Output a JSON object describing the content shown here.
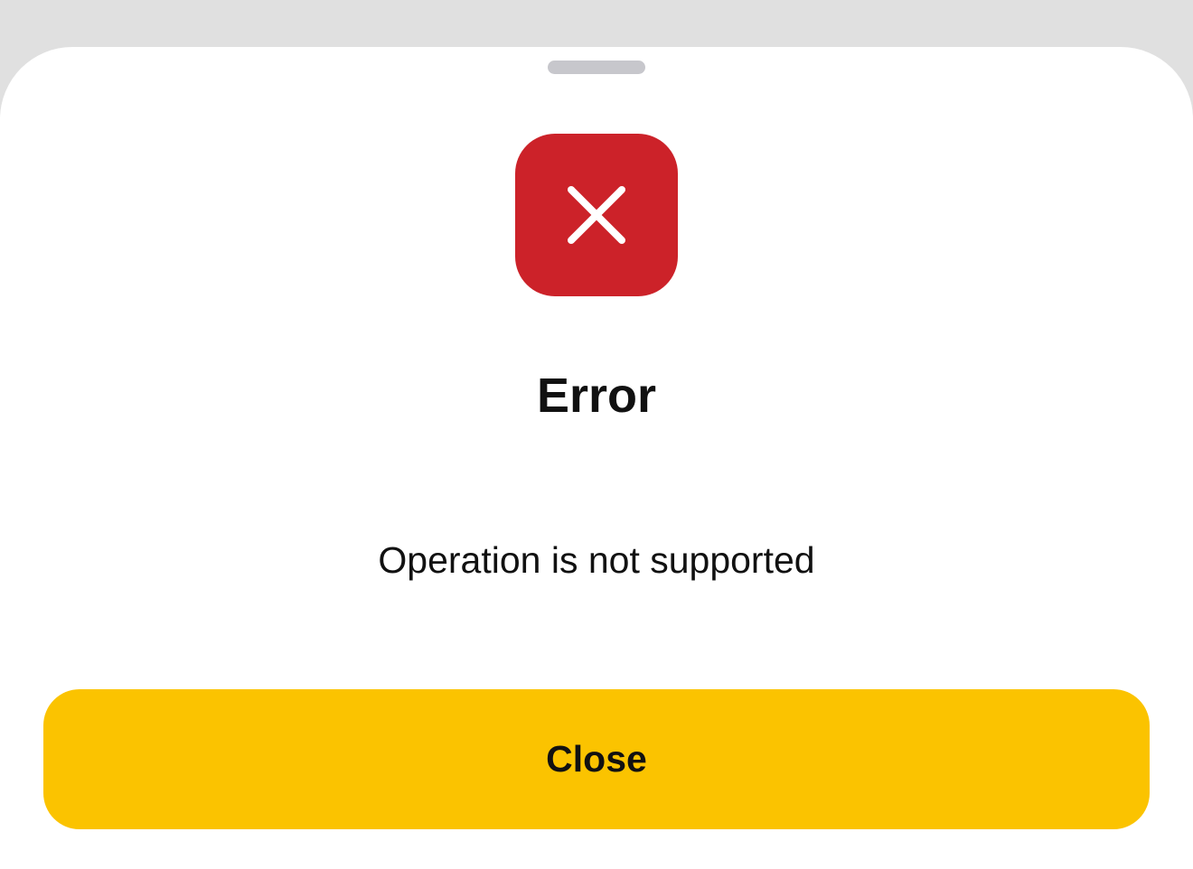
{
  "dialog": {
    "title": "Error",
    "message": "Operation is not supported",
    "close_label": "Close",
    "icon": "close-icon"
  },
  "colors": {
    "backdrop": "#e0e0e0",
    "sheet": "#ffffff",
    "error_red": "#cc2229",
    "button_yellow": "#fbc300",
    "text": "#111111"
  }
}
